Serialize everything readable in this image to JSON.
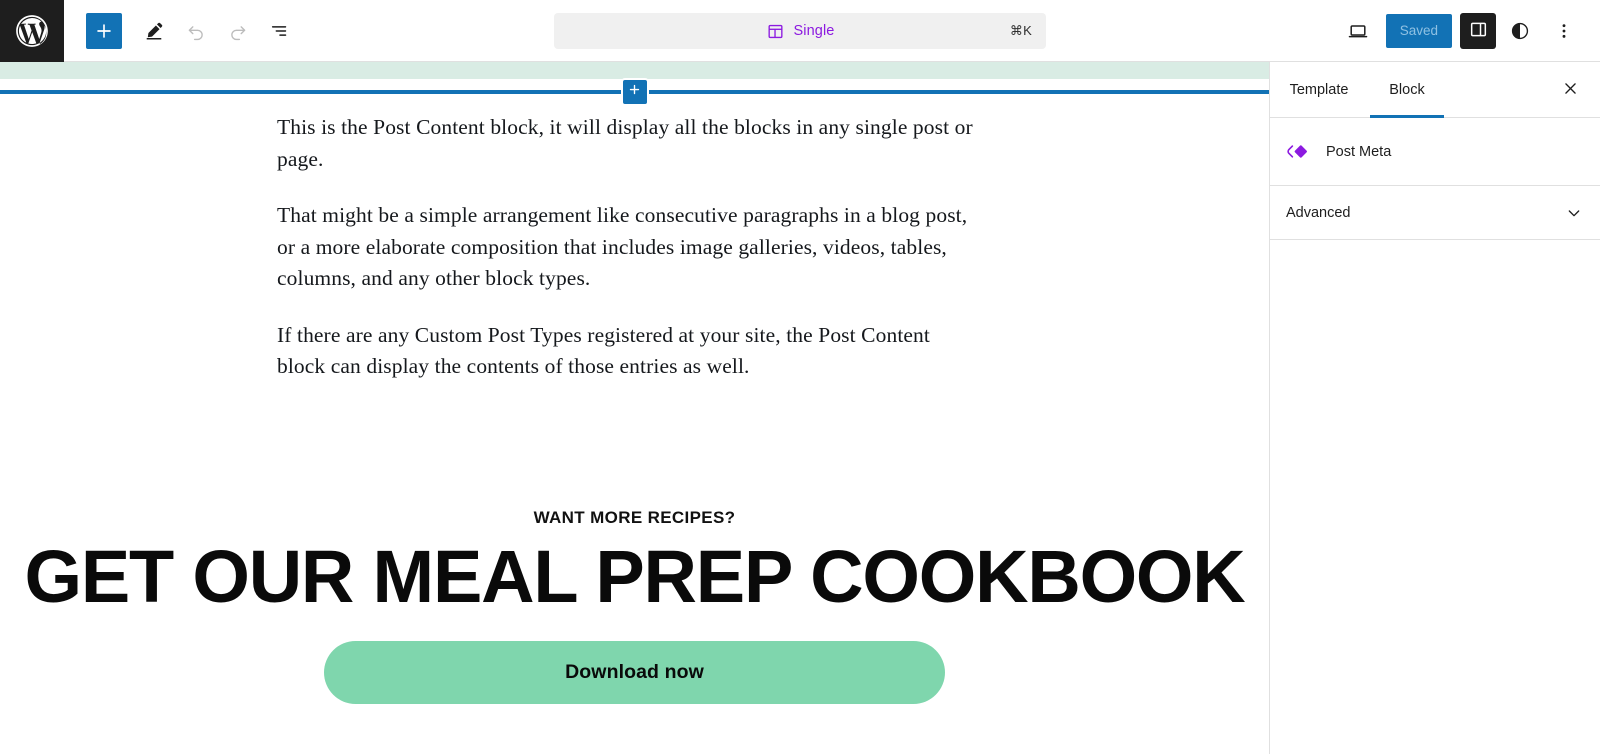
{
  "header": {
    "logo_icon": "wordpress-logo-icon",
    "tools": [
      {
        "name": "block-inserter-toggle",
        "icon": "plus-icon",
        "label": "Toggle block inserter",
        "state": "primary"
      },
      {
        "name": "edit-mode-tool",
        "icon": "pencil-icon",
        "label": "Edit",
        "state": "active"
      },
      {
        "name": "undo-button",
        "icon": "undo-icon",
        "label": "Undo",
        "state": "disabled"
      },
      {
        "name": "redo-button",
        "icon": "redo-icon",
        "label": "Redo",
        "state": "disabled"
      },
      {
        "name": "document-overview-button",
        "icon": "list-view-icon",
        "label": "Document Overview",
        "state": "default"
      }
    ],
    "command_bar": {
      "icon": "template-layout-icon",
      "label": "Single",
      "shortcut": "⌘K",
      "accent_color": "#8c1ae0"
    },
    "right_tools": {
      "device_preview_label": "View",
      "device_preview_icon": "desktop-icon",
      "save_label": "Saved",
      "save_color": "#1272b5",
      "sidebar_toggle_icon": "sidebar-panel-icon",
      "styles_icon": "styles-contrast-icon",
      "options_icon": "more-vertical-icon"
    }
  },
  "canvas": {
    "inserter_icon": "plus-icon",
    "post_content": {
      "paragraphs": [
        "This is the Post Content block, it will display all the blocks in any single post or page.",
        "That might be a simple arrangement like consecutive paragraphs in a blog post, or a more elaborate composition that includes image galleries, videos, tables, columns, and any other block types.",
        "If there are any Custom Post Types registered at your site, the Post Content block can display the contents of those entries as well."
      ]
    },
    "cta": {
      "eyebrow": "WANT MORE RECIPES?",
      "heading": "GET OUR MEAL PREP COOKBOOK",
      "button_label": "Download now",
      "button_color": "#7fd6ad"
    },
    "template_part_highlight_color": "#d9ece4",
    "inserter_line_color": "#1272b5"
  },
  "sidebar": {
    "tabs": [
      {
        "label": "Template",
        "active": false
      },
      {
        "label": "Block",
        "active": true
      }
    ],
    "close_icon": "close-icon",
    "selected_block": {
      "icon": "post-meta-icon",
      "title": "Post Meta",
      "icon_color": "#8c1ae0"
    },
    "panels": [
      {
        "label": "Advanced",
        "expanded": false,
        "chevron": "chevron-down-icon"
      }
    ]
  }
}
